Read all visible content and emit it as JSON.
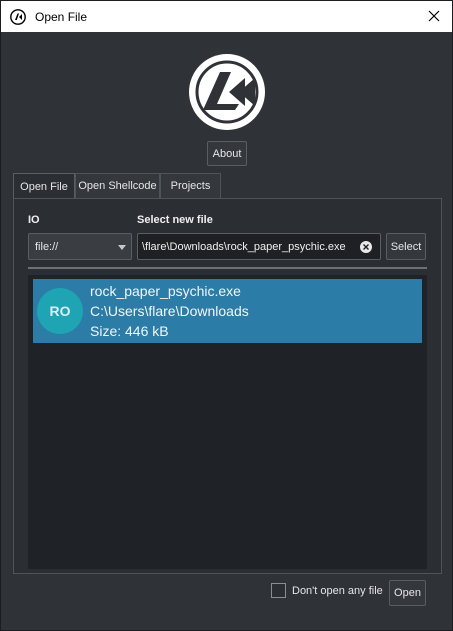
{
  "window": {
    "title": "Open File",
    "app_icon": "iaito-logo-icon",
    "close_icon": "close-icon"
  },
  "about_label": "About",
  "tabs": [
    {
      "label": "Open File",
      "active": true
    },
    {
      "label": "Open Shellcode",
      "active": false
    },
    {
      "label": "Projects",
      "active": false
    }
  ],
  "form": {
    "io_label": "IO",
    "io_value": "file://",
    "file_label": "Select new file",
    "file_value": "\\flare\\Downloads\\rock_paper_psychic.exe",
    "select_label": "Select",
    "clear_icon": "clear-icon"
  },
  "recent_files": [
    {
      "avatar_text": "RO",
      "name": "rock_paper_psychic.exe",
      "path": "C:\\Users\\flare\\Downloads",
      "size": "Size: 446 kB"
    }
  ],
  "footer": {
    "dont_open_label": "Don't open any file",
    "dont_open_checked": false,
    "open_label": "Open"
  },
  "colors": {
    "accent": "#2b7ca6",
    "avatar": "#1ea4b3",
    "background": "#2f3237"
  }
}
